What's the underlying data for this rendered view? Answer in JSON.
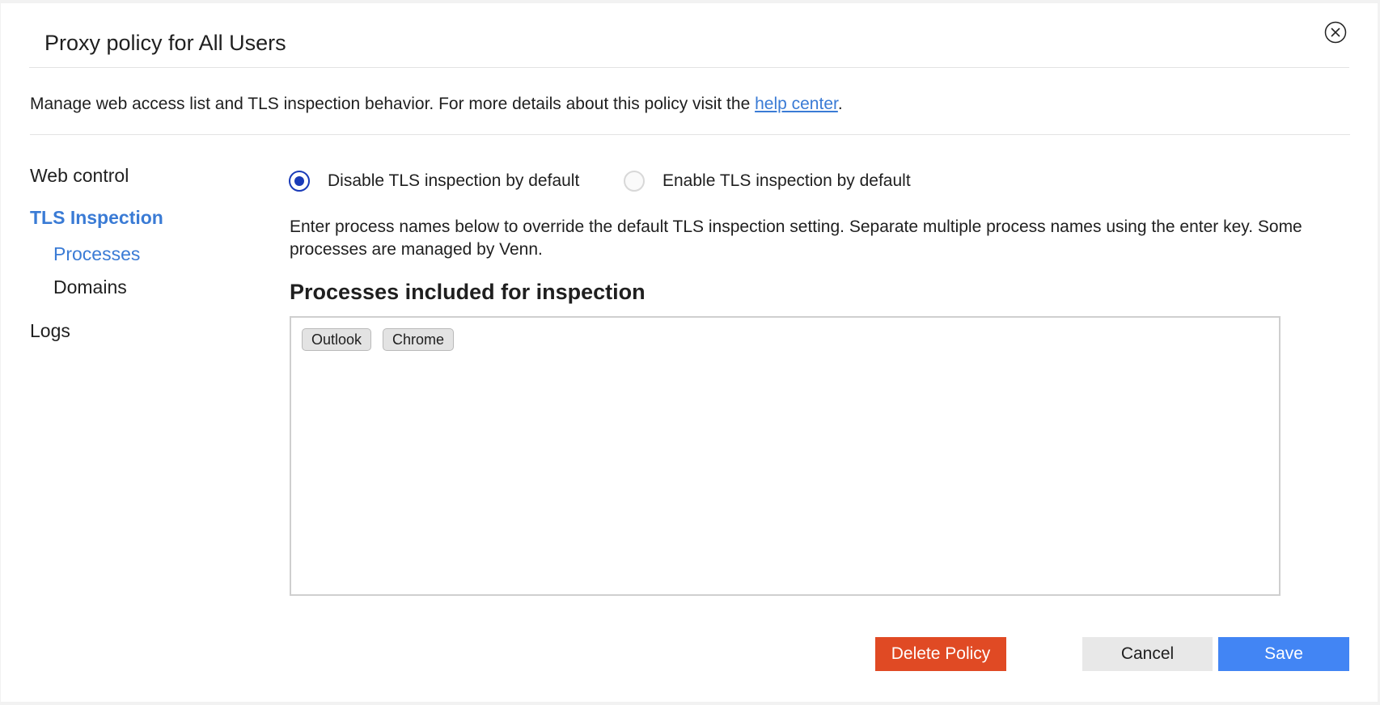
{
  "dialog": {
    "title": "Proxy policy for All Users",
    "description_prefix": "Manage web access list and TLS inspection behavior. For more details about this policy visit the ",
    "help_link": "help center",
    "description_suffix": "."
  },
  "sidebar": {
    "items": [
      {
        "label": "Web control",
        "active": false
      },
      {
        "label": "TLS Inspection",
        "active": true
      },
      {
        "label": "Processes",
        "active": true
      },
      {
        "label": "Domains",
        "active": false
      },
      {
        "label": "Logs",
        "active": false
      }
    ]
  },
  "tls": {
    "radio_options": [
      {
        "label": "Disable TLS inspection by default",
        "checked": true
      },
      {
        "label": "Enable TLS inspection by default",
        "checked": false
      }
    ],
    "help_text": "Enter process names below to override the default TLS inspection setting. Separate multiple process names using the enter key. Some processes are managed by Venn.",
    "section_heading": "Processes included for inspection",
    "processes": [
      "Outlook",
      "Chrome"
    ]
  },
  "footer": {
    "delete_label": "Delete Policy",
    "cancel_label": "Cancel",
    "save_label": "Save"
  },
  "colors": {
    "accent": "#3a7bd5",
    "radio_checked": "#1a3bb8",
    "delete": "#e04a24",
    "save": "#4285f4"
  }
}
